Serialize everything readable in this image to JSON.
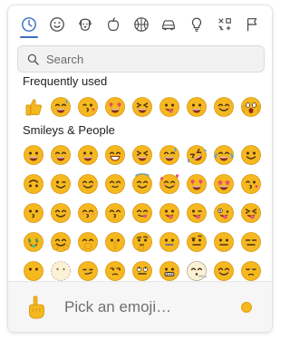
{
  "categories": [
    {
      "name": "recent",
      "icon": "clock-icon"
    },
    {
      "name": "smileys",
      "icon": "smiley-icon"
    },
    {
      "name": "animals",
      "icon": "dog-icon"
    },
    {
      "name": "food",
      "icon": "apple-icon"
    },
    {
      "name": "activity",
      "icon": "ball-icon"
    },
    {
      "name": "travel",
      "icon": "car-icon"
    },
    {
      "name": "objects",
      "icon": "lightbulb-icon"
    },
    {
      "name": "symbols",
      "icon": "symbols-icon"
    },
    {
      "name": "flags",
      "icon": "flag-icon"
    }
  ],
  "active_category": "recent",
  "search": {
    "placeholder": "Search"
  },
  "sections": {
    "frequent_title": "Frequently used",
    "smileys_title": "Smileys & People"
  },
  "frequent": [
    "thumbs-up",
    "grin-sweat",
    "kiss-wink",
    "heart-eyes",
    "squint-grin",
    "tongue",
    "grin",
    "smile-blush",
    "screaming"
  ],
  "smileys": [
    "grin-big",
    "grin-eyes",
    "grin",
    "beam",
    "squint-grin",
    "sweat-grin",
    "rofl",
    "joy",
    "smile",
    "upside-down",
    "wink",
    "blush",
    "smile-small",
    "halo",
    "hearts",
    "heart-eyes",
    "star-struck",
    "kiss-wink",
    "kiss",
    "smile-closed",
    "kiss-smile",
    "kiss-closed",
    "yum",
    "tongue-out",
    "tongue-wink",
    "zany",
    "squint-tongue",
    "money-mouth",
    "hug",
    "hand-mouth",
    "shush",
    "think",
    "zipper-mouth",
    "raised-eyebrow",
    "neutral",
    "expressionless",
    "no-mouth",
    "dotted-face",
    "smirk",
    "unamused",
    "eye-roll",
    "grimace",
    "exhale",
    "relieved",
    "pensive"
  ],
  "footer": {
    "preview_icon": "pointing-up-icon",
    "label": "Pick an emoji…",
    "skin_tone_color": "#f5b81f"
  },
  "colors": {
    "accent": "#3b6fbf",
    "emoji_face": "#f5b81f"
  }
}
